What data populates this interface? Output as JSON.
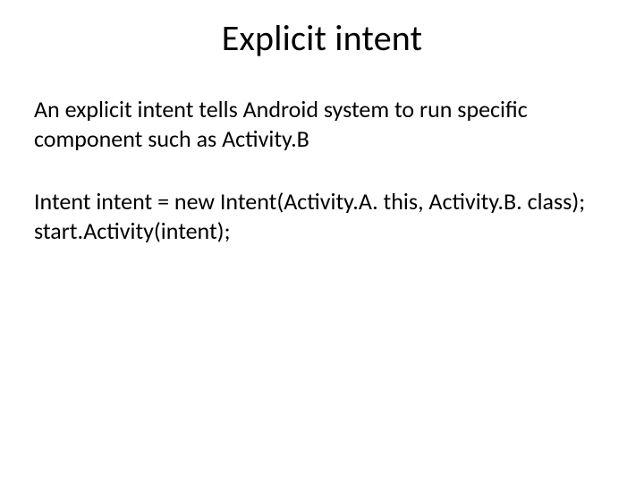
{
  "title": "Explicit intent",
  "intro": "An explicit intent tells Android system to run specific component such as Activity.B",
  "code_line1": "Intent intent = new Intent(Activity.A. this, Activity.B. class);",
  "code_line2": "start.Activity(intent);"
}
